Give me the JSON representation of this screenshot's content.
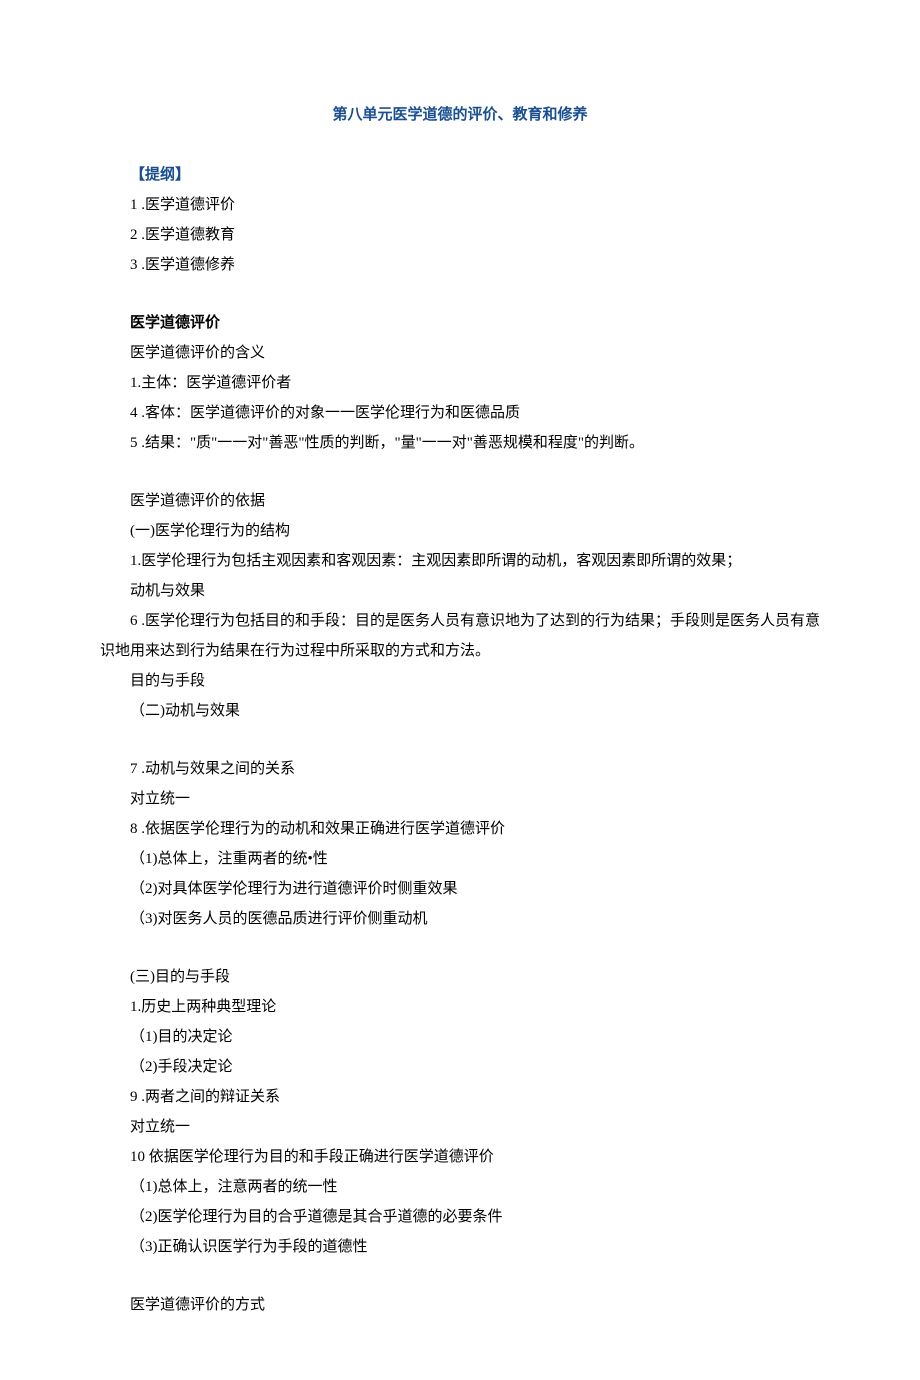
{
  "title": "第八单元医学道德的评价、教育和修养",
  "outline": {
    "header": "【提纲】",
    "items": [
      "1 .医学道德评价",
      "2 .医学道德教育",
      "3 .医学道德修养"
    ]
  },
  "section1": {
    "header": "医学道德评价",
    "sub1": {
      "title": "医学道德评价的含义",
      "lines": [
        "1.主体：医学道德评价者",
        "4 .客体：医学道德评价的对象一一医学伦理行为和医德品质",
        "5 .结果：\"质\"一一对\"善恶\"性质的判断，\"量\"一一对\"善恶规模和程度\"的判断。"
      ]
    },
    "sub2": {
      "title": "医学道德评价的依据",
      "p1": "(一)医学伦理行为的结构",
      "p2": "1.医学伦理行为包括主观因素和客观因素：主观因素即所谓的动机，客观因素即所谓的效果；",
      "p3": "动机与效果",
      "p4": "6 .医学伦理行为包括目的和手段：目的是医务人员有意识地为了达到的行为结果；手段则是医务人员有意识地用来达到行为结果在行为过程中所采取的方式和方法。",
      "p5": "目的与手段",
      "p6": "（二)动机与效果",
      "p7": "7 .动机与效果之间的关系",
      "p8": "对立统一",
      "p9": "8 .依据医学伦理行为的动机和效果正确进行医学道德评价",
      "p10": "（1)总体上，注重两者的统•性",
      "p11": "（2)对具体医学伦理行为进行道德评价时侧重效果",
      "p12": "（3)对医务人员的医德品质进行评价侧重动机",
      "p13": "(三)目的与手段",
      "p14": "1.历史上两种典型理论",
      "p15": "（1)目的决定论",
      "p16": "（2)手段决定论",
      "p17": "9 .两者之间的辩证关系",
      "p18": "对立统一",
      "p19": "10 依据医学伦理行为目的和手段正确进行医学道德评价",
      "p20": "（1)总体上，注意两者的统一性",
      "p21": "（2)医学伦理行为目的合乎道德是其合乎道德的必要条件",
      "p22": "（3)正确认识医学行为手段的道德性"
    },
    "sub3": {
      "title": "医学道德评价的方式"
    }
  }
}
